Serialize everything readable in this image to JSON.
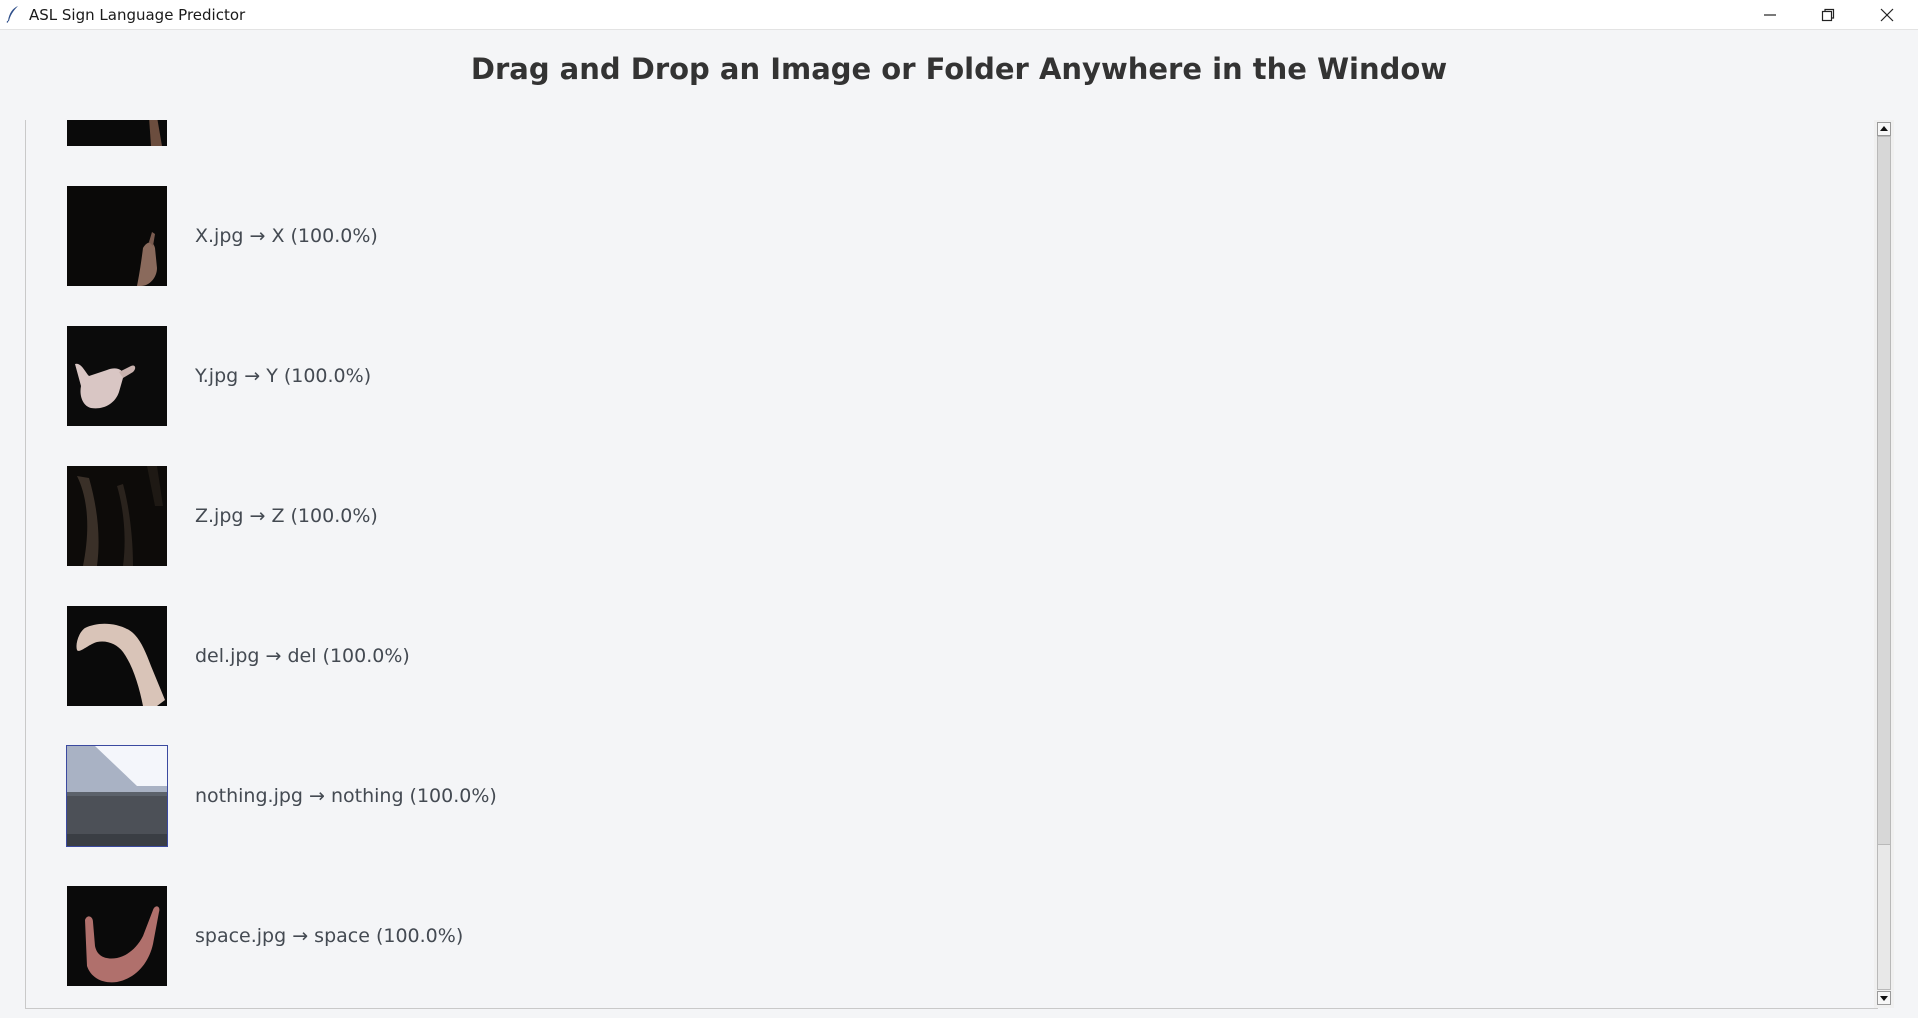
{
  "window": {
    "title": "ASL Sign Language Predictor",
    "icon": "feather-icon",
    "controls": [
      "minimize-icon",
      "restore-icon",
      "close-icon"
    ]
  },
  "header": {
    "instruction": "Drag and Drop an Image or Folder Anywhere in the Window"
  },
  "results": [
    {
      "filename": "X.jpg",
      "label": "X.jpg → X (100.0%)",
      "prediction": "X",
      "confidence": "100.0%"
    },
    {
      "filename": "Y.jpg",
      "label": "Y.jpg → Y (100.0%)",
      "prediction": "Y",
      "confidence": "100.0%"
    },
    {
      "filename": "Z.jpg",
      "label": "Z.jpg → Z (100.0%)",
      "prediction": "Z",
      "confidence": "100.0%"
    },
    {
      "filename": "del.jpg",
      "label": "del.jpg → del (100.0%)",
      "prediction": "del",
      "confidence": "100.0%"
    },
    {
      "filename": "nothing.jpg",
      "label": "nothing.jpg → nothing (100.0%)",
      "prediction": "nothing",
      "confidence": "100.0%"
    },
    {
      "filename": "space.jpg",
      "label": "space.jpg → space (100.0%)",
      "prediction": "space",
      "confidence": "100.0%"
    }
  ],
  "scrollbar": {
    "position": "bottom"
  },
  "colors": {
    "background": "#f4f5f7",
    "header_text": "#333333",
    "label_text": "#444a52"
  }
}
